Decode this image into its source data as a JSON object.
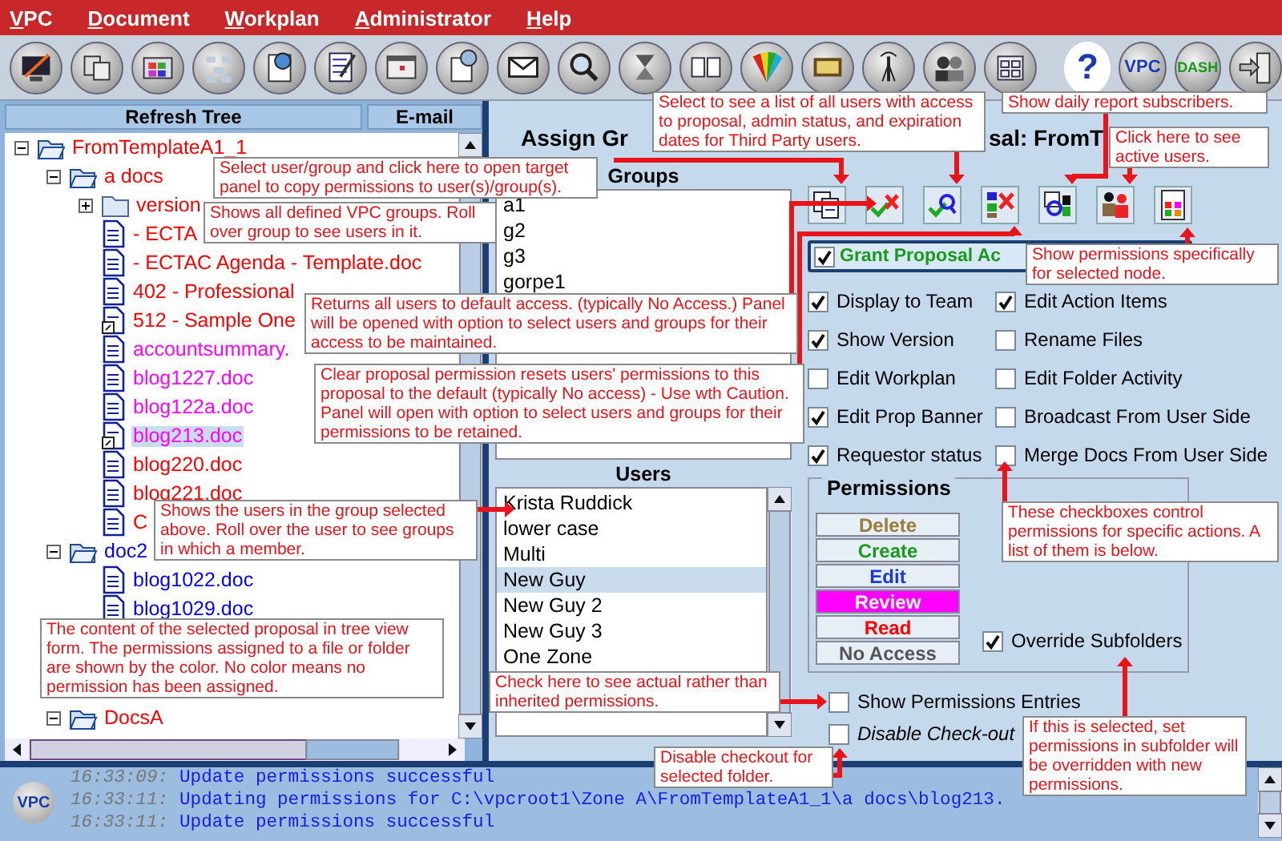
{
  "menu": [
    "VPC",
    "Document",
    "Workplan",
    "Administrator",
    "Help"
  ],
  "toolbar": {
    "text_buttons": [
      "?",
      "VPC",
      "DASH"
    ]
  },
  "tree_panel": {
    "buttons": [
      "Refresh Tree",
      "E-mail"
    ],
    "tree": [
      {
        "label": "FromTemplateA1_1",
        "kind": "folder",
        "color": "#ff0000",
        "expanded": true,
        "selected": false,
        "children": [
          {
            "label": "a docs",
            "kind": "folder",
            "color": "#ff0000",
            "expanded": true,
            "selected": false,
            "children": [
              {
                "label": "version",
                "kind": "folder",
                "color": "#ff0000",
                "expanded": false,
                "selected": false
              },
              {
                "label": "- ECTA",
                "kind": "doc",
                "color": "#ff0000",
                "selected": false
              },
              {
                "label": "- ECTAC Agenda - Template.doc",
                "kind": "doc",
                "color": "#ff0000",
                "selected": false
              },
              {
                "label": "402 - Professional",
                "kind": "doc",
                "color": "#ff0000",
                "selected": false
              },
              {
                "label": "512 - Sample One",
                "kind": "linked_doc",
                "color": "#ff0000",
                "selected": false
              },
              {
                "label": "accountsummary.",
                "kind": "doc",
                "color": "#ff00ff",
                "selected": false
              },
              {
                "label": "blog1227.doc",
                "kind": "doc",
                "color": "#ff00ff",
                "selected": false
              },
              {
                "label": "blog122a.doc",
                "kind": "doc",
                "color": "#ff00ff",
                "selected": false
              },
              {
                "label": "blog213.doc",
                "kind": "linked_doc",
                "color": "#ff00ff",
                "selected": true
              },
              {
                "label": "blog220.doc",
                "kind": "doc",
                "color": "#ff0000",
                "selected": false
              },
              {
                "label": "blog221.doc",
                "kind": "doc",
                "color": "#ff0000",
                "selected": false
              },
              {
                "label": "C",
                "kind": "doc",
                "color": "#ff0000",
                "selected": false
              }
            ]
          },
          {
            "label": "doc2",
            "kind": "folder",
            "color": "#0000ff",
            "expanded": true,
            "selected": false,
            "children": [
              {
                "label": "blog1022.doc",
                "kind": "doc",
                "color": "#0000ff",
                "selected": false
              },
              {
                "label": "blog1029.doc",
                "kind": "doc",
                "color": "#0000ff",
                "selected": false
              }
            ]
          },
          {
            "label": "DocsA",
            "kind": "folder",
            "color": "#ff0000",
            "expanded": true,
            "selected": false
          }
        ]
      }
    ]
  },
  "assign": {
    "title_start": "Assign Gr",
    "title_end": "sal: FromT",
    "groups": {
      "heading": "Groups",
      "items": [
        {
          "label": "a1",
          "selected": false
        },
        {
          "label": "g2",
          "selected": false
        },
        {
          "label": "g3",
          "selected": false
        },
        {
          "label": "gorpe1",
          "selected": false
        }
      ]
    },
    "users": {
      "heading": "Users",
      "items": [
        {
          "label": "Krista Ruddick",
          "selected": false
        },
        {
          "label": "lower case",
          "selected": false
        },
        {
          "label": "Multi",
          "selected": false
        },
        {
          "label": "New Guy",
          "selected": true
        },
        {
          "label": "New Guy 2",
          "selected": false
        },
        {
          "label": "New Guy 3",
          "selected": false
        },
        {
          "label": "One Zone",
          "selected": false
        }
      ]
    },
    "grant": {
      "label": "Grant Proposal Ac",
      "checked": true
    },
    "actions": [
      {
        "label": "Display to Team",
        "checked": true
      },
      {
        "label": "Edit Action Items",
        "checked": true
      },
      {
        "label": "Show Version",
        "checked": true
      },
      {
        "label": "Rename Files",
        "checked": false
      },
      {
        "label": "Edit Workplan",
        "checked": false
      },
      {
        "label": "Edit Folder Activity",
        "checked": false
      },
      {
        "label": "Edit Prop Banner",
        "checked": true
      },
      {
        "label": "Broadcast From User Side",
        "checked": false
      },
      {
        "label": "Requestor status",
        "checked": true
      },
      {
        "label": "Merge Docs From User Side",
        "checked": false
      }
    ],
    "permissions": {
      "heading": "Permissions",
      "buttons": [
        {
          "label": "Delete",
          "color": "#9c7a3c",
          "selected": false
        },
        {
          "label": "Create",
          "color": "#1a9a1a",
          "selected": false
        },
        {
          "label": "Edit",
          "color": "#1a3ae0",
          "selected": false
        },
        {
          "label": "Review",
          "color": "#ff00ff",
          "selected": true
        },
        {
          "label": "Read",
          "color": "#ff0000",
          "selected": false
        },
        {
          "label": "No Access",
          "color": "#555555",
          "selected": false
        }
      ],
      "override": {
        "label": "Override Subfolders",
        "checked": true
      }
    },
    "show_entries": {
      "label": "Show Permissions Entries",
      "checked": false
    },
    "disable_checkout": {
      "label": "Disable Check-out",
      "checked": false
    }
  },
  "log": {
    "logo": "VPC",
    "lines": [
      {
        "time": "16:33:09:",
        "message": "Update permissions successful"
      },
      {
        "time": "16:33:11:",
        "message": "Updating permissions for C:\\vpcroot1\\Zone A\\FromTemplateA1_1\\a docs\\blog213."
      },
      {
        "time": "16:33:11:",
        "message": "Update permissions successful"
      }
    ]
  },
  "callouts": [
    "Select to see a list of all users with access to proposal, admin status, and expiration dates for Third Party users.",
    "Show daily report subscribers.",
    "Click here to see active users.",
    "Select user/group and click here to open target panel to copy permissions to user(s)/group(s).",
    "Shows all defined VPC groups.  Roll over group to see users in it.",
    "Show permissions specifically for selected node.",
    "Returns all users to default access. (typically No Access.) Panel will be opened with option to select users and groups for their access to be maintained.",
    "Clear proposal permission resets users' permissions to this proposal to the default (typically No access) - Use wth Caution. Panel will open with option to select users and groups for their permissions to be retained.",
    "Shows the users in the group selected above.  Roll over the user to see groups in which a member.",
    "These checkboxes control permissions for specific actions. A list of them is below.",
    "The content of the selected proposal in tree view form.  The permissions assigned to a file or folder are shown by the color.  No color means no permission has been assigned.",
    "Check here to see actual rather than inherited permissions.",
    "If this is selected, set permissions in subfolder will be overridden with new permissions.",
    "Disable checkout for selected folder."
  ]
}
